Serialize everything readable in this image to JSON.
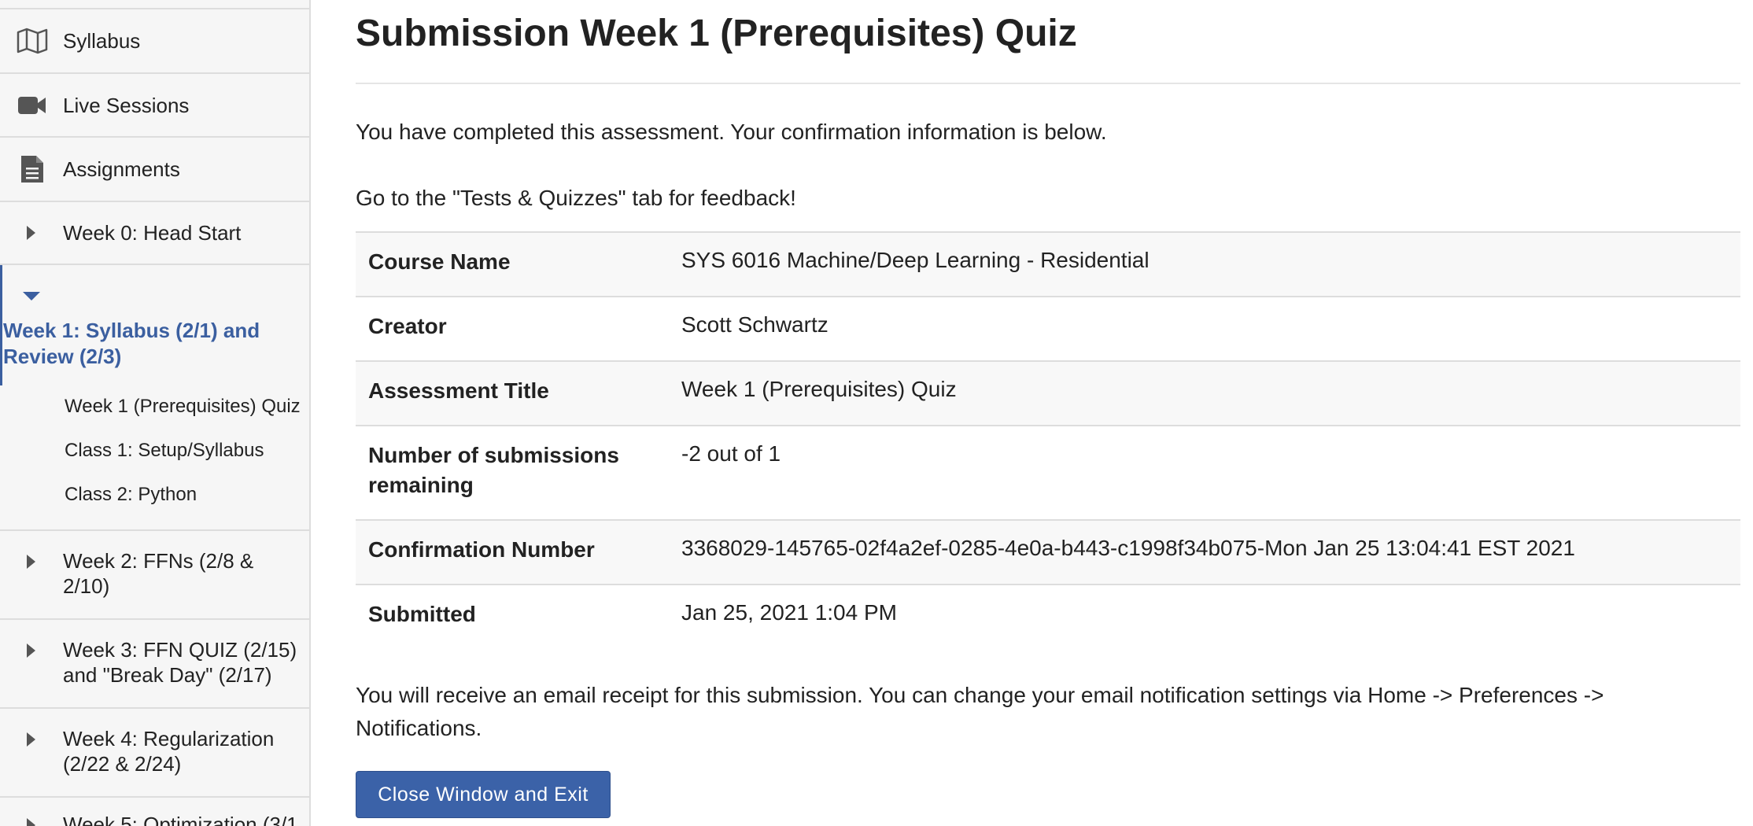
{
  "sidebar": {
    "items": [
      {
        "label": "Syllabus",
        "icon": "map-icon"
      },
      {
        "label": "Live Sessions",
        "icon": "video-camera-icon"
      },
      {
        "label": "Assignments",
        "icon": "document-icon"
      }
    ],
    "weeks": [
      {
        "label": "Week 0: Head Start",
        "expanded": false
      },
      {
        "label": "Week 1: Syllabus (2/1) and Review (2/3)",
        "expanded": true,
        "children": [
          "Week 1 (Prerequisites) Quiz",
          "Class 1: Setup/Syllabus",
          "Class 2: Python"
        ]
      },
      {
        "label": "Week 2: FFNs (2/8 & 2/10)",
        "expanded": false
      },
      {
        "label": "Week 3: FFN QUIZ (2/15) and \"Break Day\" (2/17)",
        "expanded": false
      },
      {
        "label": "Week 4: Regularization (2/22 & 2/24)",
        "expanded": false
      },
      {
        "label": "Week 5: Optimization (3/1",
        "expanded": false
      }
    ]
  },
  "main": {
    "title_prefix": "Submission",
    "title_rest": "Week 1 (Prerequisites) Quiz",
    "completed_text": "You have completed this assessment. Your confirmation information is below.",
    "feedback_text": "Go to the \"Tests & Quizzes\" tab for feedback!",
    "info_rows": [
      {
        "label": "Course Name",
        "value": "SYS 6016 Machine/Deep Learning - Residential"
      },
      {
        "label": "Creator",
        "value": "Scott Schwartz"
      },
      {
        "label": "Assessment Title",
        "value": "Week 1 (Prerequisites) Quiz"
      },
      {
        "label": "Number of submissions remaining",
        "value": "-2 out of 1"
      },
      {
        "label": "Confirmation Number",
        "value": "3368029-145765-02f4a2ef-0285-4e0a-b443-c1998f34b075-Mon Jan 25 13:04:41 EST 2021"
      },
      {
        "label": "Submitted",
        "value": "Jan 25, 2021 1:04 PM"
      }
    ],
    "email_text": "You will receive an email receipt for this submission. You can change your email notification settings via Home -> Preferences -> Notifications.",
    "close_button_label": "Close Window and Exit"
  },
  "colors": {
    "accent": "#3b5fa0",
    "button": "#3b62a8",
    "sidebar_bg": "#f6f6f6",
    "divider": "#dddddd"
  }
}
